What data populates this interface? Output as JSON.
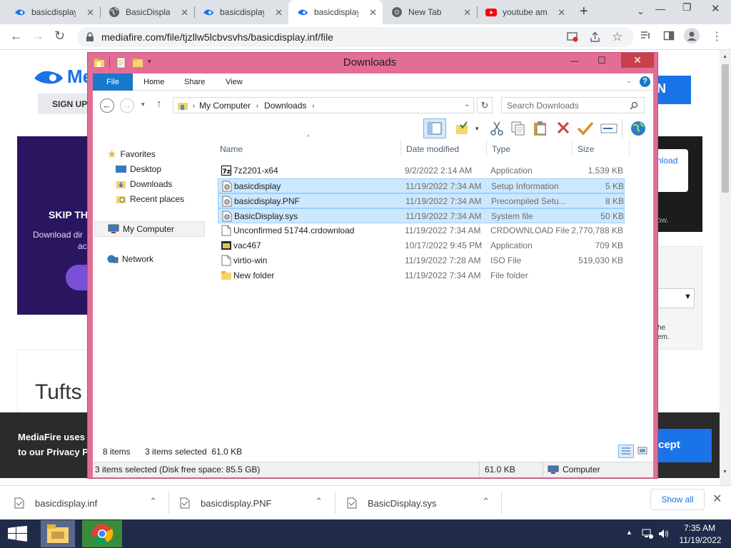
{
  "browser": {
    "tabs": [
      {
        "label": "basicdisplay"
      },
      {
        "label": "BasicDisplay"
      },
      {
        "label": "basicdisplay"
      },
      {
        "label": "basicdisplay"
      },
      {
        "label": "New Tab"
      },
      {
        "label": "youtube aml"
      }
    ],
    "url": "mediafire.com/file/tjzllw5lcbvsvhs/basicdisplay.inf/file"
  },
  "page": {
    "sign_up": "SIGN UP",
    "skip": "SKIP TH",
    "download_line1": "Download dir",
    "download_line2": "ac",
    "tufts": "Tufts",
    "cookie_line1": "MediaFire uses c",
    "cookie_line2": "to our Privacy Po",
    "accept": "cept",
    "side_download": "nload",
    "side_now": "ow.",
    "side_the": "he",
    "side_em": "em.",
    "logo_text": "Me"
  },
  "explorer": {
    "title": "Downloads",
    "ribbon_tabs": [
      "File",
      "Home",
      "Share",
      "View"
    ],
    "breadcrumb": [
      "My Computer",
      "Downloads"
    ],
    "search_placeholder": "Search Downloads",
    "nav": {
      "favorites": "Favorites",
      "desktop": "Desktop",
      "downloads": "Downloads",
      "recent": "Recent places",
      "computer": "My Computer",
      "network": "Network"
    },
    "columns": {
      "name": "Name",
      "date": "Date modified",
      "type": "Type",
      "size": "Size"
    },
    "files": [
      {
        "name": "7z2201-x64",
        "date": "9/2/2022 2:14 AM",
        "type": "Application",
        "size": "1,539 KB",
        "icon": "7zip-icon",
        "selected": false
      },
      {
        "name": "basicdisplay",
        "date": "11/19/2022 7:34 AM",
        "type": "Setup Information",
        "size": "5 KB",
        "icon": "setup-info-icon",
        "selected": true
      },
      {
        "name": "basicdisplay.PNF",
        "date": "11/19/2022 7:34 AM",
        "type": "Precompiled Setu...",
        "size": "8 KB",
        "icon": "pnf-icon",
        "selected": true
      },
      {
        "name": "BasicDisplay.sys",
        "date": "11/19/2022 7:34 AM",
        "type": "System file",
        "size": "50 KB",
        "icon": "system-file-icon",
        "selected": true
      },
      {
        "name": "Unconfirmed 51744.crdownload",
        "date": "11/19/2022 7:34 AM",
        "type": "CRDOWNLOAD File",
        "size": "2,770,788 KB",
        "icon": "blank-file-icon",
        "selected": false
      },
      {
        "name": "vac467",
        "date": "10/17/2022 9:45 PM",
        "type": "Application",
        "size": "709 KB",
        "icon": "app-icon",
        "selected": false
      },
      {
        "name": "virtio-win",
        "date": "11/19/2022 7:28 AM",
        "type": "ISO File",
        "size": "519,030 KB",
        "icon": "blank-file-icon",
        "selected": false
      },
      {
        "name": "New folder",
        "date": "11/19/2022 7:34 AM",
        "type": "File folder",
        "size": "",
        "icon": "folder-icon",
        "selected": false
      }
    ],
    "item_count": "8 items",
    "selected_info": "3 items selected  61.0 KB",
    "status_left": "3 items selected (Disk free space: 85.5 GB)",
    "status_size": "61.0 KB",
    "status_computer": "Computer"
  },
  "shelf": {
    "items": [
      {
        "label": "basicdisplay.inf"
      },
      {
        "label": "basicdisplay.PNF"
      },
      {
        "label": "BasicDisplay.sys"
      }
    ],
    "show_all": "Show all"
  },
  "taskbar": {
    "time": "7:35 AM",
    "date": "11/19/2022"
  }
}
